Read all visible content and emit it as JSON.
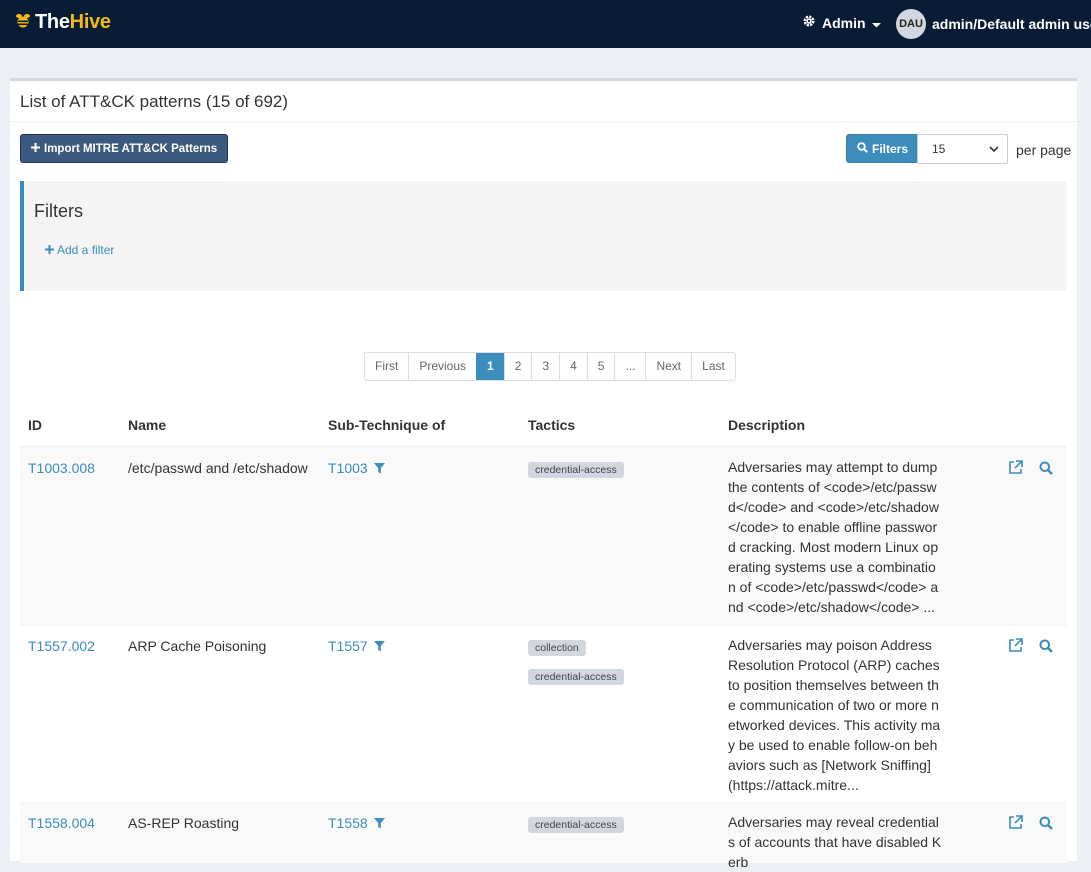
{
  "app": {
    "logo_the": "The",
    "logo_hive": "Hive"
  },
  "header": {
    "admin_label": "Admin",
    "avatar_initials": "DAU",
    "user_label": "admin/Default admin user"
  },
  "page": {
    "title": "List of ATT&CK patterns (15 of 692)",
    "import_button": "Import MITRE ATT&CK Patterns",
    "filters_button": "Filters",
    "per_page_value": "15",
    "per_page_label": "per page"
  },
  "filters": {
    "title": "Filters",
    "add_filter": "Add a filter"
  },
  "pagination": [
    "First",
    "Previous",
    "1",
    "2",
    "3",
    "4",
    "5",
    "...",
    "Next",
    "Last"
  ],
  "table": {
    "columns": [
      "ID",
      "Name",
      "Sub-Technique of",
      "Tactics",
      "Description"
    ],
    "rows": [
      {
        "id": "T1003.008",
        "name": "/etc/passwd and /etc/shadow",
        "parent": "T1003",
        "tactics": [
          "credential-access"
        ],
        "description": "Adversaries may attempt to dump the contents of <code>/etc/passwd</code> and <code>/etc/shadow</code> to enable offline password cracking. Most modern Linux operating systems use a combination of <code>/etc/passwd</code> and <code>/etc/shadow</code> ..."
      },
      {
        "id": "T1557.002",
        "name": "ARP Cache Poisoning",
        "parent": "T1557",
        "tactics": [
          "collection",
          "credential-access"
        ],
        "description": "Adversaries may poison Address Resolution Protocol (ARP) caches to position themselves between the communication of two or more networked devices. This activity may be used to enable follow-on behaviors such as [Network Sniffing](https://attack.mitre..."
      },
      {
        "id": "T1558.004",
        "name": "AS-REP Roasting",
        "parent": "T1558",
        "tactics": [
          "credential-access"
        ],
        "description": "Adversaries may reveal credentials of accounts that have disabled Kerb"
      }
    ]
  }
}
